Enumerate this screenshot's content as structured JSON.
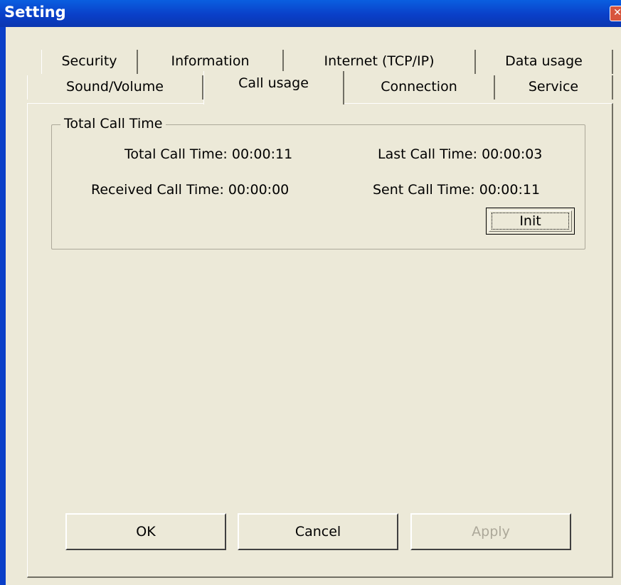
{
  "window": {
    "title": "Setting"
  },
  "tabs_row1": [
    "Security",
    "Information",
    "Internet (TCP/IP)",
    "Data usage"
  ],
  "tabs_row2": [
    "Sound/Volume",
    "Call usage",
    "Connection",
    "Service"
  ],
  "active_tab": "Call usage",
  "group": {
    "title": "Total Call Time",
    "total_call_time": "Total Call Time: 00:00:11",
    "last_call_time": "Last Call Time: 00:00:03",
    "received_call_time": "Received Call Time: 00:00:00",
    "sent_call_time": "Sent Call Time: 00:00:11",
    "init_label": "Init"
  },
  "buttons": {
    "ok": "OK",
    "cancel": "Cancel",
    "apply": "Apply"
  },
  "icons": {
    "close": "close-icon"
  }
}
